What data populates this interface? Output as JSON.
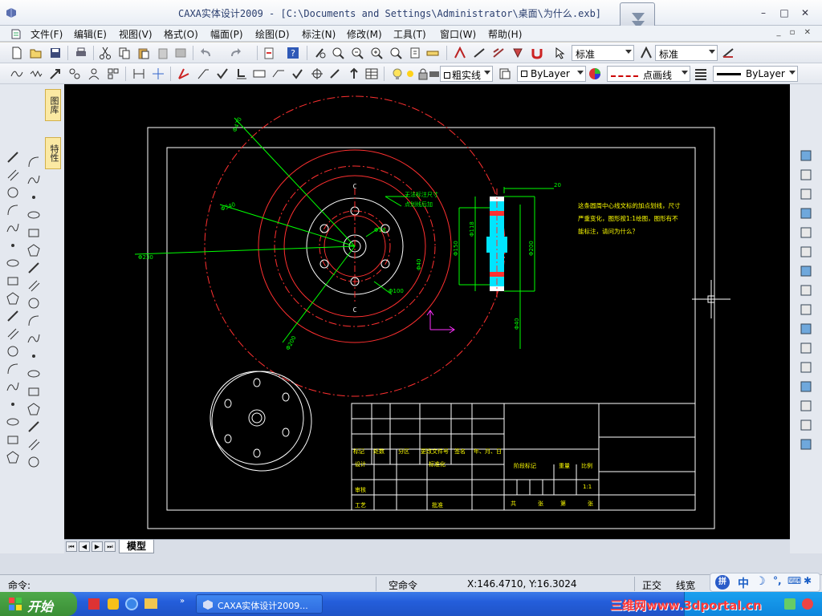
{
  "window": {
    "title": "CAXA实体设计2009 - [C:\\Documents and Settings\\Administrator\\桌面\\为什么.exb]",
    "controls": [
      "–",
      "□",
      "✕"
    ],
    "mdi_controls": "_ ▫ ✕"
  },
  "menu": {
    "items": [
      "文件(F)",
      "编辑(E)",
      "视图(V)",
      "格式(O)",
      "幅面(P)",
      "绘图(D)",
      "标注(N)",
      "修改(M)",
      "工具(T)",
      "窗口(W)",
      "帮助(H)"
    ]
  },
  "toolbar1": {
    "text_style": "标准",
    "dim_style": "标准"
  },
  "toolbar2": {
    "layer": "粗实线",
    "color": "ByLayer",
    "linetype": "点画线",
    "lineweight": "ByLayer"
  },
  "left_tabs": {
    "tab1": "图库",
    "tab2": "特性"
  },
  "drawing": {
    "note_lines": [
      "这条圆周中心线文标的加点划线，尺寸",
      "严重变化，图形按1:1绘图，图形有不",
      "能标注，请问为什么？"
    ],
    "label_leader": [
      "无法标注尺寸",
      "点划线后加"
    ],
    "section_marks": [
      "C",
      "C"
    ],
    "dims": {
      "d_outer1": "Φ470",
      "d_outer2": "Φ340",
      "d_outer3": "Φ230",
      "d_outer4": "Φ200",
      "d_center": "Φ18",
      "d_bolt": "Φ40",
      "d_hole": "Φ100",
      "sec_top": "20",
      "sec_d1": "Φ118",
      "sec_d2": "Φ150",
      "sec_d3": "Φ200",
      "sec_d4": "Φ40"
    },
    "title_block": {
      "row_labels": [
        "标记",
        "处数",
        "分区",
        "更改文件号",
        "签名",
        "年、月、日"
      ],
      "design": "设计",
      "standard": "标准化",
      "review": "审核",
      "process": "工艺",
      "approve": "批准",
      "stage": "阶段标记",
      "weight": "重量",
      "scale": "比例",
      "scale_val": "1:1",
      "sheets": [
        "共",
        "张",
        "第",
        "张"
      ]
    }
  },
  "tabs": {
    "model": "模型"
  },
  "status": {
    "prompt": "命令:",
    "state": "空命令",
    "coords": "X:146.4710, Y:16.3024",
    "ortho": "正交",
    "lineweight": "线宽"
  },
  "taskbar": {
    "start": "开始",
    "task": "CAXA实体设计2009..."
  },
  "ime": {
    "label": "中"
  },
  "watermark": "三维网www.3dportal.cn",
  "colors": {
    "canvas_bg": "#000000",
    "red": "#ff3030",
    "green": "#00ff00",
    "white": "#ffffff",
    "cyan": "#00e5ff",
    "magenta": "#ff30ff",
    "yellow": "#ffff00"
  }
}
